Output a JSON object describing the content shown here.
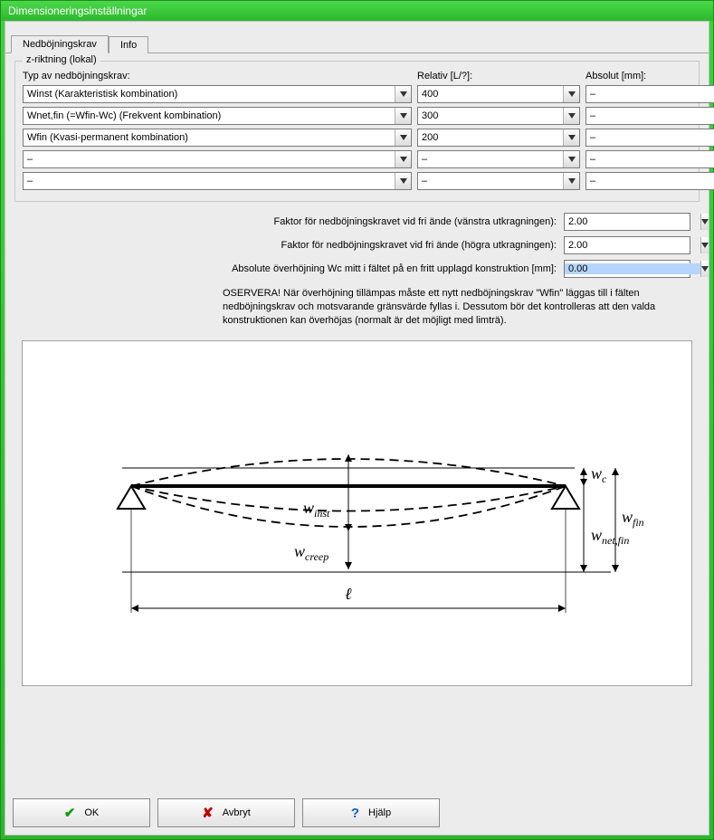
{
  "window": {
    "title": "Dimensioneringsinställningar"
  },
  "tabs": {
    "active": "Nedböjningskrav",
    "inactive": "Info"
  },
  "group": {
    "label": "z-riktning (lokal)",
    "headers": {
      "type": "Typ av nedböjningskrav:",
      "rel": "Relativ [L/?]:",
      "abs": "Absolut [mm]:"
    },
    "rows": [
      {
        "type": "Winst (Karakteristisk kombination)",
        "rel": "400",
        "abs": "–"
      },
      {
        "type": "Wnet,fin (=Wfin-Wc) (Frekvent kombination)",
        "rel": "300",
        "abs": "–"
      },
      {
        "type": "Wfin (Kvasi-permanent kombination)",
        "rel": "200",
        "abs": "–"
      },
      {
        "type": "–",
        "rel": "–",
        "abs": "–"
      },
      {
        "type": "–",
        "rel": "–",
        "abs": "–"
      }
    ]
  },
  "settings": {
    "left_cantilever_label": "Faktor för nedböjningskravet vid fri ände (vänstra utkragningen):",
    "left_cantilever_value": "2.00",
    "right_cantilever_label": "Faktor för nedböjningskravet vid fri ände (högra utkragningen):",
    "right_cantilever_value": "2.00",
    "camber_label": "Absolute överhöjning Wc mitt i fältet på en fritt upplagd konstruktion [mm]:",
    "camber_value": "0.00"
  },
  "note": "OSERVERA! När överhöjning tillämpas måste ett nytt nedböjningskrav \"Wfin\" läggas till i fälten nedböjningskrav och motsvarande gränsvärde fyllas i. Dessutom bör det kontrolleras att den valda konstruktionen kan överhöjas (normalt är det möjligt med limträ).",
  "diagram_labels": {
    "w_inst": "w",
    "w_inst_sub": "inst",
    "w_creep": "w",
    "w_creep_sub": "creep",
    "wc": "w",
    "wc_sub": "c",
    "w_netfin": "w",
    "w_netfin_sub": "net,fin",
    "w_fin": "w",
    "w_fin_sub": "fin",
    "ell": "ℓ"
  },
  "buttons": {
    "ok": "OK",
    "cancel": "Avbryt",
    "help": "Hjälp"
  }
}
